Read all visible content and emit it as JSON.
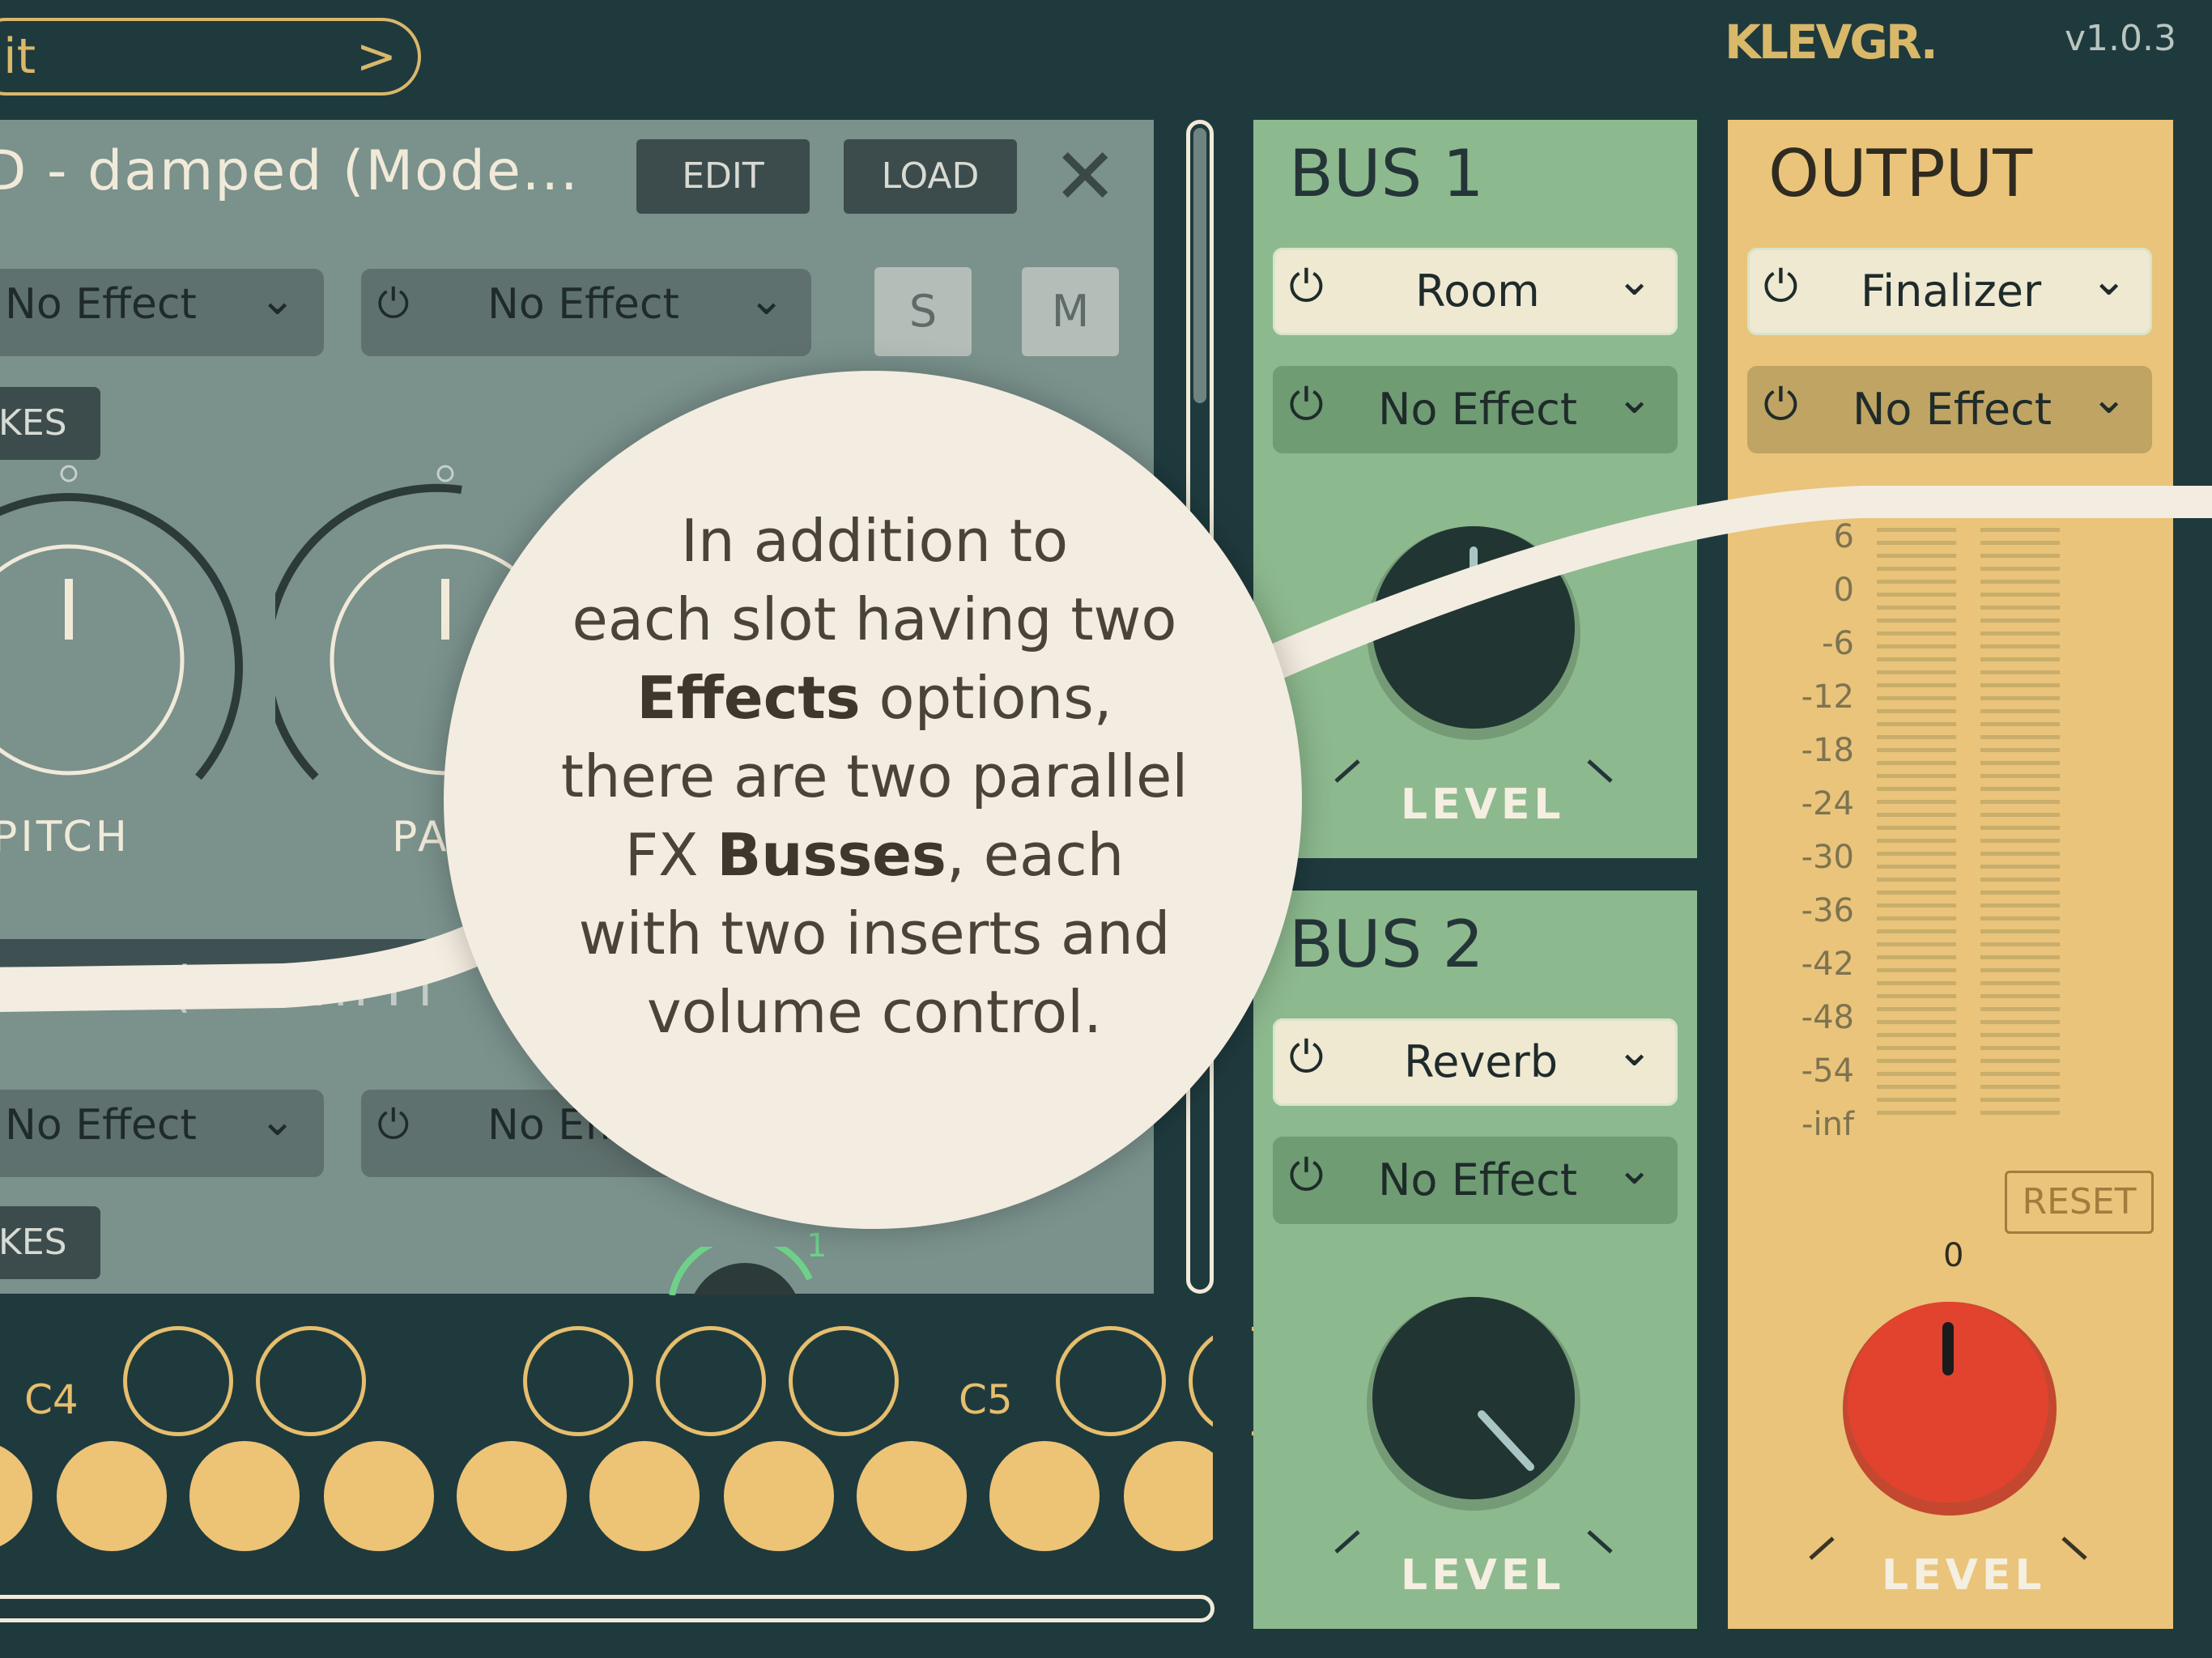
{
  "header": {
    "kit_label": "it",
    "brand": "KLEVGR.",
    "version": "v1.0.3"
  },
  "slot1": {
    "title": "D - damped (Mode...",
    "edit_label": "EDIT",
    "load_label": "LOAD",
    "effect_a": "No Effect",
    "effect_b": "No Effect",
    "solo_label": "S",
    "mute_label": "M",
    "tag_label": "KES",
    "knob1_label": "PITCH",
    "knob2_label": "PA"
  },
  "slot2": {
    "title_partial": "( odern Pi",
    "effect_a": "No Effect",
    "effect_b": "No Eff",
    "tag_label": "KES",
    "indicator": "1"
  },
  "keyboard": {
    "note_c4": "C4",
    "note_c5": "C5"
  },
  "bus1": {
    "title": "BUS 1",
    "insert1": "Room",
    "insert2": "No Effect",
    "level_label": "LEVEL"
  },
  "bus2": {
    "title": "BUS 2",
    "insert1": "Reverb",
    "insert2": "No Effect",
    "level_label": "LEVEL"
  },
  "output": {
    "title": "OUTPUT",
    "insert1": "Finalizer",
    "insert2": "No Effect",
    "meter_scale": [
      "6",
      "0",
      "-6",
      "-12",
      "-18",
      "-24",
      "-30",
      "-36",
      "-42",
      "-48",
      "-54",
      "-inf"
    ],
    "reset_label": "RESET",
    "level_value": "0",
    "level_label": "LEVEL"
  },
  "callout": {
    "line1": "In addition to",
    "line2": "each slot having two",
    "line3_bold": "Effects",
    "line3_rest": " options,",
    "line4": "there are two parallel",
    "line5_pre": "FX ",
    "line5_bold": "Busses",
    "line5_rest": ", each",
    "line6": "with two inserts and",
    "line7": "volume control."
  },
  "icons": {
    "power": "power-icon",
    "chevron": "chevron-down-icon",
    "close": "close-icon"
  },
  "colors": {
    "background": "#1f3a3d",
    "bus": "#8db98e",
    "output": "#e9c47a",
    "gold_accent": "#d9b86a",
    "output_knob": "#e2432e"
  }
}
